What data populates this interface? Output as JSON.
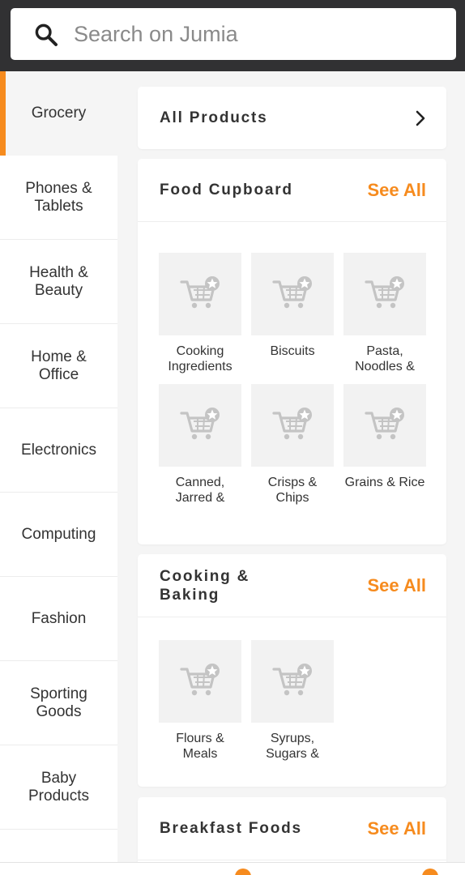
{
  "search": {
    "placeholder": "Search on Jumia"
  },
  "sidebar": {
    "items": [
      {
        "label": "Grocery",
        "active": true
      },
      {
        "label": "Phones & Tablets"
      },
      {
        "label": "Health & Beauty"
      },
      {
        "label": "Home & Office"
      },
      {
        "label": "Electronics"
      },
      {
        "label": "Computing"
      },
      {
        "label": "Fashion"
      },
      {
        "label": "Sporting Goods"
      },
      {
        "label": "Baby Products"
      }
    ]
  },
  "main": {
    "all_products": "All Products",
    "see_all": "See All",
    "sections": [
      {
        "title": "Food Cupboard",
        "items": [
          "Cooking Ingredients",
          "Biscuits",
          "Pasta, Noodles & S…",
          "Canned, Jarred & Pac…",
          "Crisps & Chips",
          "Grains & Rice"
        ]
      },
      {
        "title": "Cooking & Baking",
        "items": [
          "Flours & Meals",
          "Syrups, Sugars & Sw…"
        ]
      },
      {
        "title": "Breakfast Foods",
        "items": []
      }
    ]
  },
  "colors": {
    "accent": "#f68b1e",
    "topbar": "#313133"
  },
  "icons": {
    "search": "search-icon",
    "chevron": "chevron-right-icon",
    "placeholder": "cart-placeholder-icon"
  }
}
